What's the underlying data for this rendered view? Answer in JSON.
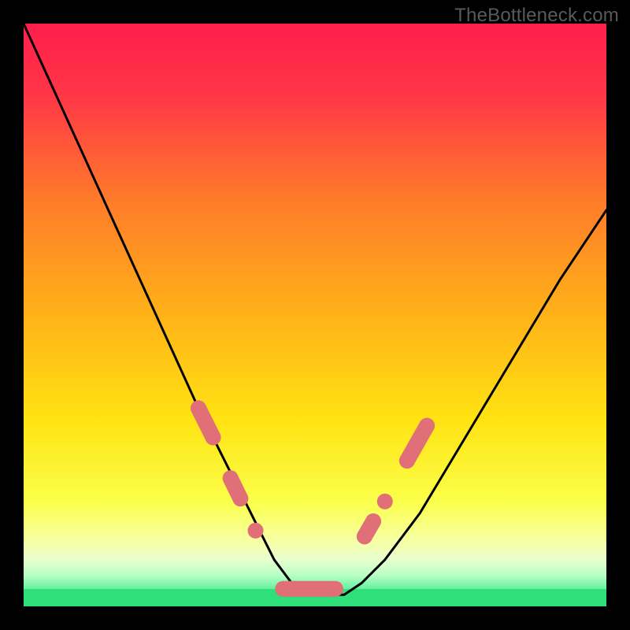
{
  "watermark": "TheBottleneck.com",
  "chart_data": {
    "type": "line",
    "title": "",
    "xlabel": "",
    "ylabel": "",
    "xlim": [
      0,
      100
    ],
    "ylim": [
      0,
      100
    ],
    "series": [
      {
        "name": "bottleneck-curve",
        "x": [
          0,
          5,
          10,
          15,
          20,
          25,
          30,
          35,
          40,
          43,
          46,
          49,
          52,
          55,
          58,
          62,
          68,
          74,
          80,
          86,
          92,
          100
        ],
        "y": [
          100,
          89,
          78,
          67,
          56,
          45,
          34,
          24,
          14,
          8,
          4,
          2,
          2,
          2,
          4,
          8,
          16,
          26,
          36,
          46,
          56,
          68
        ]
      }
    ],
    "markers": [
      {
        "name": "left-dot-1",
        "x": 30.0,
        "y": 34.0
      },
      {
        "name": "left-dot-2",
        "x": 32.5,
        "y": 29.0
      },
      {
        "name": "left-dot-3",
        "x": 35.5,
        "y": 22.0
      },
      {
        "name": "left-dot-4",
        "x": 37.2,
        "y": 18.5
      },
      {
        "name": "left-dot-5",
        "x": 39.8,
        "y": 13.0
      },
      {
        "name": "right-dot-1",
        "x": 58.5,
        "y": 12.0
      },
      {
        "name": "right-dot-2",
        "x": 60.0,
        "y": 14.6
      },
      {
        "name": "right-dot-3",
        "x": 62.0,
        "y": 18.0
      },
      {
        "name": "right-dot-4",
        "x": 65.8,
        "y": 25.0
      },
      {
        "name": "right-dot-5",
        "x": 67.5,
        "y": 28.0
      },
      {
        "name": "right-dot-6",
        "x": 69.2,
        "y": 31.0
      }
    ],
    "segments": [
      {
        "name": "left-pill-upper",
        "x1": 30.0,
        "y1": 34.0,
        "x2": 32.5,
        "y2": 29.0
      },
      {
        "name": "left-pill-lower",
        "x1": 35.5,
        "y1": 22.0,
        "x2": 37.2,
        "y2": 18.5
      },
      {
        "name": "valley-pill",
        "x1": 44.5,
        "y1": 3.0,
        "x2": 53.5,
        "y2": 3.0
      },
      {
        "name": "right-pill-lower",
        "x1": 58.5,
        "y1": 12.0,
        "x2": 60.0,
        "y2": 14.6
      },
      {
        "name": "right-pill-upper",
        "x1": 65.8,
        "y1": 25.0,
        "x2": 69.2,
        "y2": 31.0
      }
    ],
    "annotations": [],
    "colors": {
      "gradient_top": "#ff1e4b",
      "gradient_mid": "#ffd512",
      "gradient_low": "#f7ffb0",
      "valley_green": "#2fe07a",
      "marker": "#e06f78",
      "curve": "#000000",
      "frame": "#000000"
    }
  }
}
